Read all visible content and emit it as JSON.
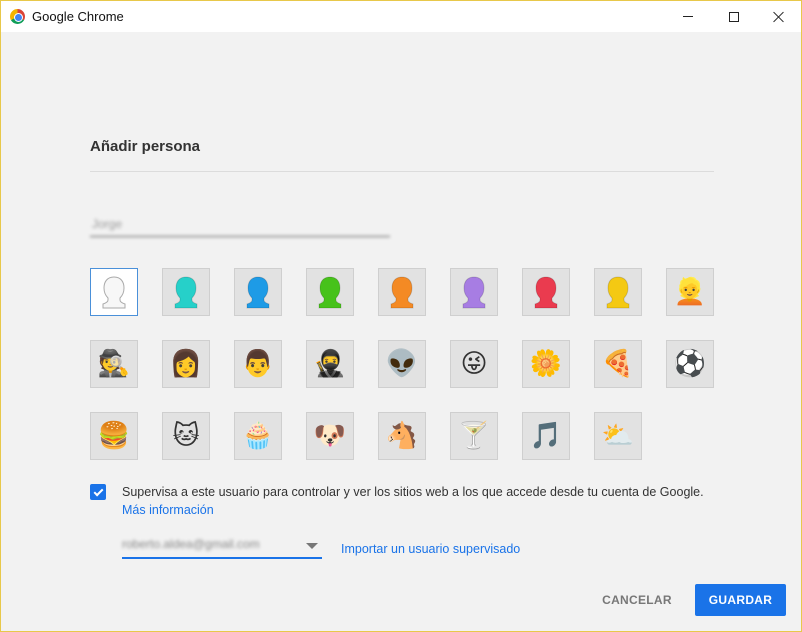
{
  "window": {
    "title": "Google Chrome"
  },
  "dialog": {
    "heading": "Añadir persona",
    "name_input_value": "Jorge",
    "avatars": [
      {
        "name": "avatar-white-silhouette",
        "kind": "silhouette",
        "color": "#f7f7f7",
        "selected": true
      },
      {
        "name": "avatar-cyan-silhouette",
        "kind": "silhouette",
        "color": "#26d0c9"
      },
      {
        "name": "avatar-blue-silhouette",
        "kind": "silhouette",
        "color": "#1e9be6"
      },
      {
        "name": "avatar-green-silhouette",
        "kind": "silhouette",
        "color": "#47c21b"
      },
      {
        "name": "avatar-orange-silhouette",
        "kind": "silhouette",
        "color": "#f48a24"
      },
      {
        "name": "avatar-purple-silhouette",
        "kind": "silhouette",
        "color": "#a77de3"
      },
      {
        "name": "avatar-red-silhouette",
        "kind": "silhouette",
        "color": "#ea3b4f"
      },
      {
        "name": "avatar-yellow-silhouette",
        "kind": "silhouette",
        "color": "#f4c913"
      },
      {
        "name": "avatar-blonde-woman",
        "kind": "emoji",
        "glyph": "👱"
      },
      {
        "name": "avatar-businessman",
        "kind": "emoji",
        "glyph": "🕵"
      },
      {
        "name": "avatar-woman",
        "kind": "emoji",
        "glyph": "👩"
      },
      {
        "name": "avatar-man",
        "kind": "emoji",
        "glyph": "👨"
      },
      {
        "name": "avatar-ninja",
        "kind": "emoji",
        "glyph": "🥷"
      },
      {
        "name": "avatar-alien",
        "kind": "emoji",
        "glyph": "👽"
      },
      {
        "name": "avatar-smiley",
        "kind": "emoji",
        "glyph": "😜"
      },
      {
        "name": "avatar-flower",
        "kind": "emoji",
        "glyph": "🌼"
      },
      {
        "name": "avatar-pizza",
        "kind": "emoji",
        "glyph": "🍕"
      },
      {
        "name": "avatar-soccer-ball",
        "kind": "emoji",
        "glyph": "⚽"
      },
      {
        "name": "avatar-burger",
        "kind": "emoji",
        "glyph": "🍔"
      },
      {
        "name": "avatar-cat",
        "kind": "emoji",
        "glyph": "🐱"
      },
      {
        "name": "avatar-cupcake",
        "kind": "emoji",
        "glyph": "🧁"
      },
      {
        "name": "avatar-dog",
        "kind": "emoji",
        "glyph": "🐶"
      },
      {
        "name": "avatar-horse",
        "kind": "emoji",
        "glyph": "🐴"
      },
      {
        "name": "avatar-cocktail",
        "kind": "emoji",
        "glyph": "🍸"
      },
      {
        "name": "avatar-music-note",
        "kind": "emoji",
        "glyph": "🎵"
      },
      {
        "name": "avatar-sun-cloud",
        "kind": "emoji",
        "glyph": "⛅"
      }
    ],
    "supervise_checked": true,
    "supervise_text": "Supervisa a este usuario para controlar y ver los sitios web a los que accede desde tu cuenta de Google.",
    "more_info_link": "Más información",
    "account_value": "roberto.aldea@gmail.com",
    "import_link": "Importar un usuario supervisado",
    "cancel_label": "CANCELAR",
    "save_label": "GUARDAR"
  }
}
